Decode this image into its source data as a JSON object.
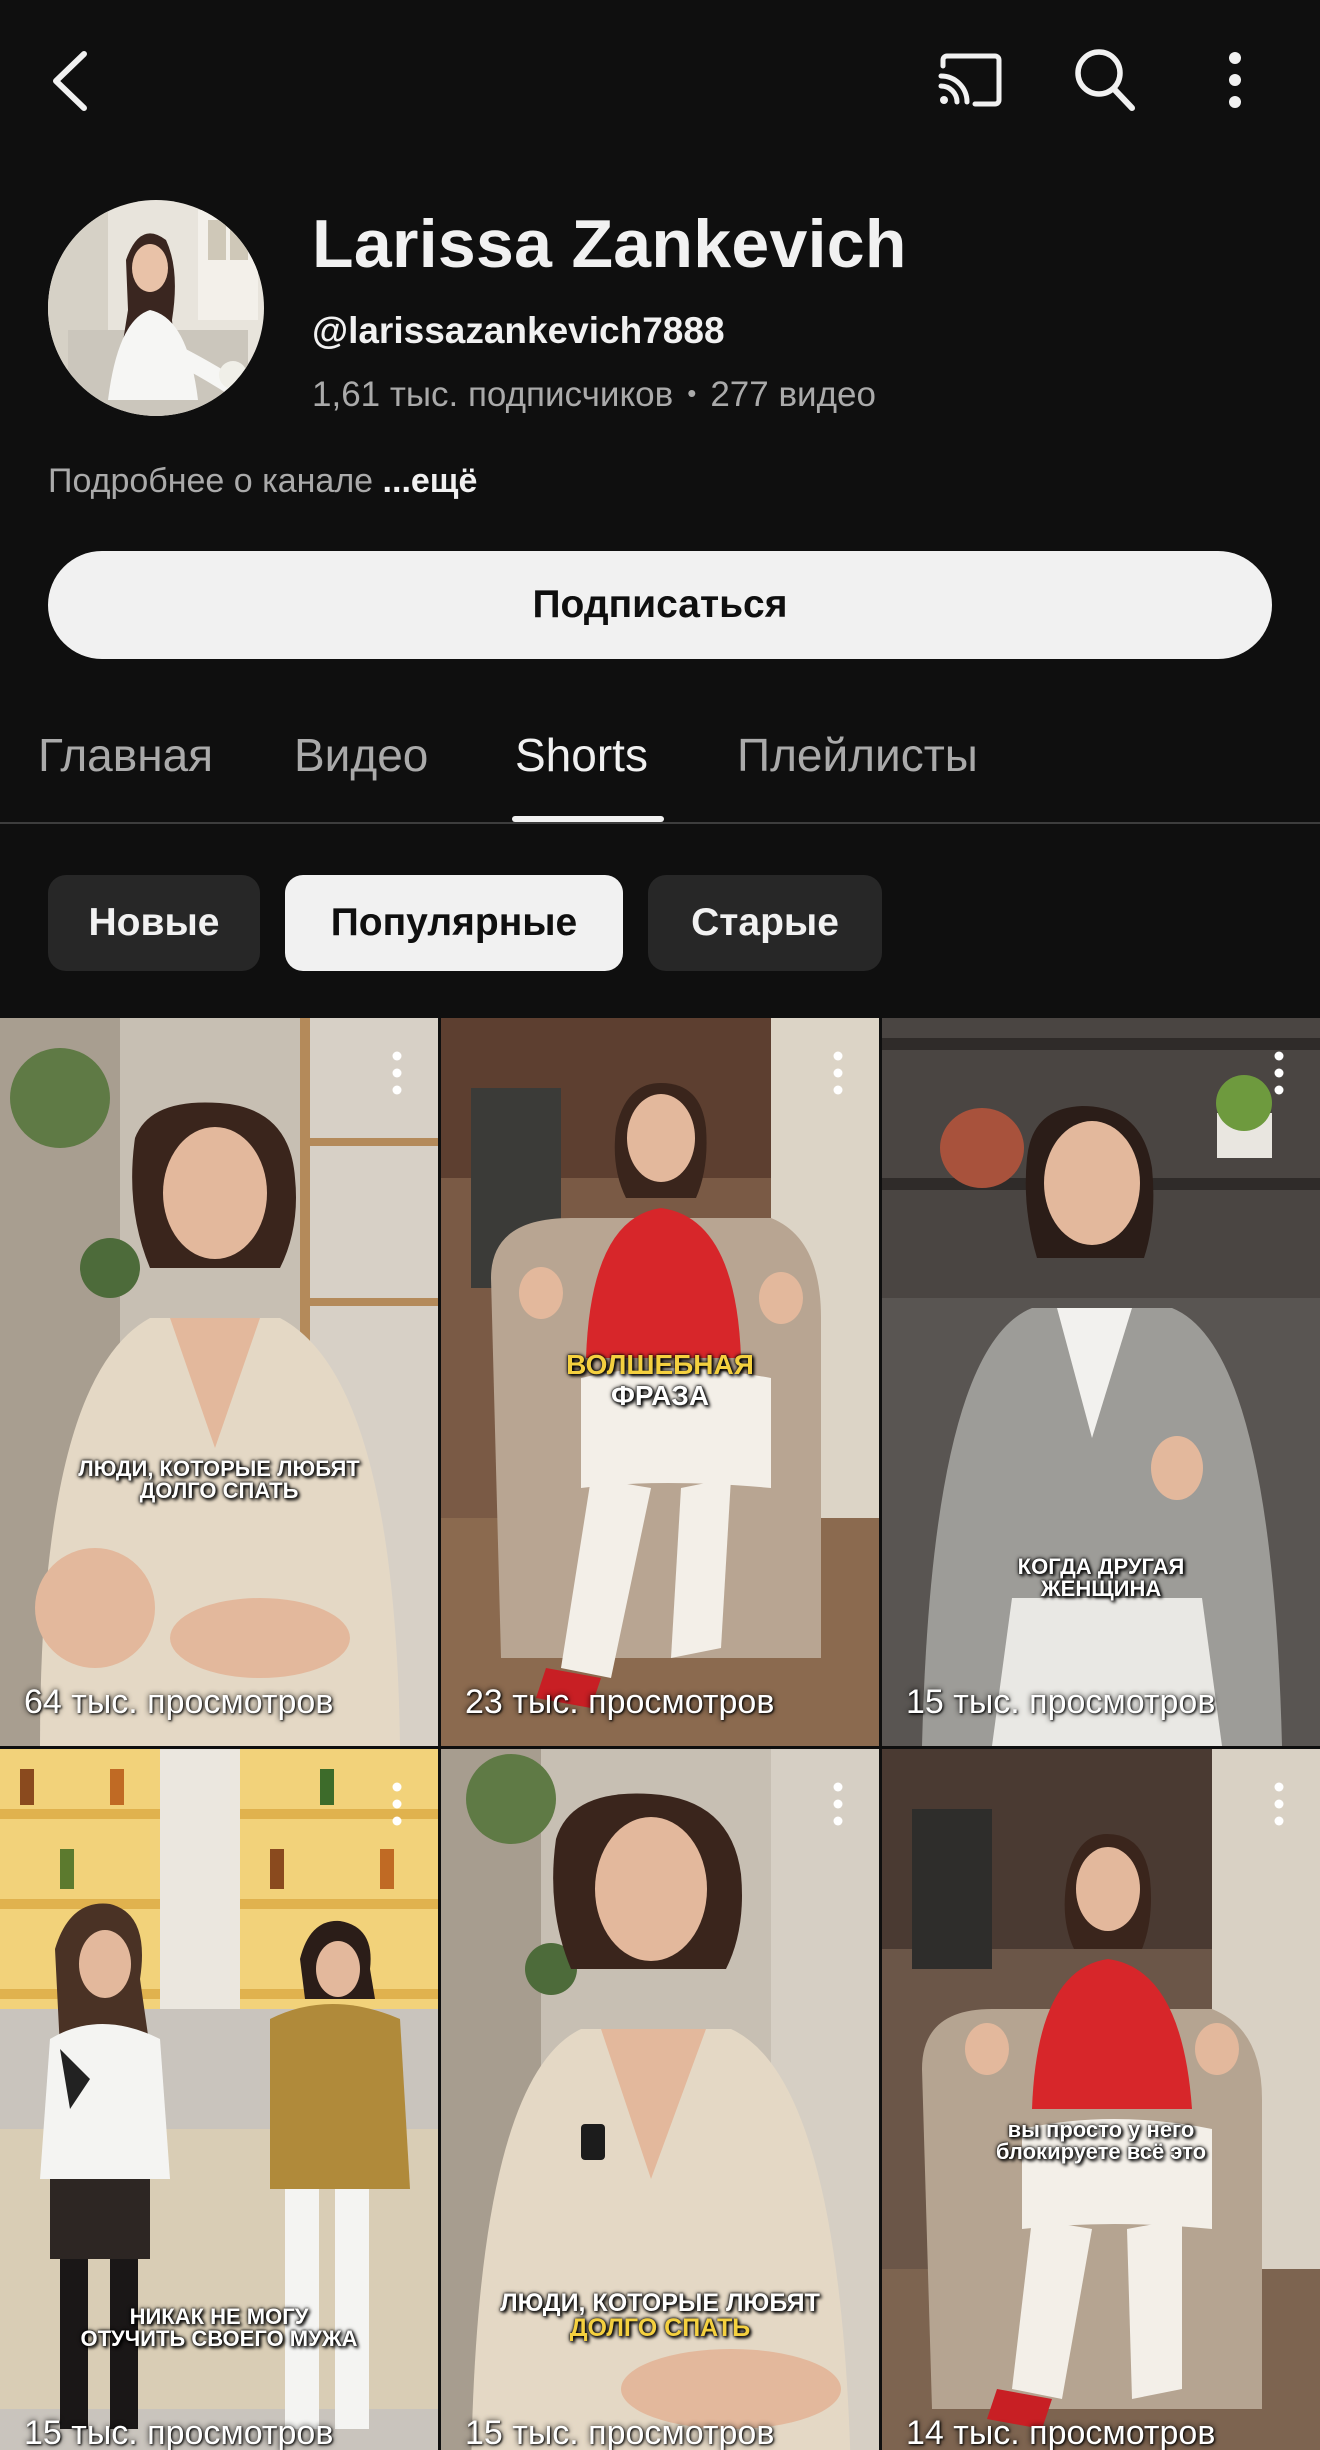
{
  "topbar": {
    "icons": [
      "back-arrow-icon",
      "cast-icon",
      "search-icon",
      "more-vertical-icon"
    ]
  },
  "channel": {
    "name": "Larissa Zankevich",
    "handle": "@larissazankevich7888",
    "subscribers": "1,61 тыс. подписчиков",
    "video_count": "277 видео",
    "about": "Подробнее о канале",
    "about_more": "...ещё",
    "subscribe_label": "Подписаться"
  },
  "tabs": [
    {
      "label": "Главная"
    },
    {
      "label": "Видео"
    },
    {
      "label": "Shorts",
      "active": true
    },
    {
      "label": "Плейлисты"
    }
  ],
  "chips": [
    {
      "label": "Новые"
    },
    {
      "label": "Популярные",
      "selected": true
    },
    {
      "label": "Старые"
    }
  ],
  "shorts": [
    {
      "caption_line1": "Люди, которые любят",
      "caption_line2": "долго спать",
      "views": "64 тыс. просмотров"
    },
    {
      "caption_line1": "Волшебная",
      "caption_line2": "фраза",
      "views": "23 тыс. просмотров"
    },
    {
      "caption_line1": "Когда другая",
      "caption_line2": "женщина",
      "views": "15 тыс. просмотров"
    },
    {
      "caption_line1": "Никак не могу",
      "caption_line2": "отучить своего мужа",
      "views": "15 тыс. просмотров"
    },
    {
      "caption_line1": "Люди, которые любят",
      "caption_line2": "долго спать",
      "views": "15 тыс. просмотров"
    },
    {
      "caption_line1": "вы просто у него",
      "caption_line2": "блокируете всё это",
      "views": "14 тыс. просмотров"
    }
  ],
  "colors": {
    "background": "#0f0f0f",
    "text_primary": "#f1f1f1",
    "text_secondary": "#aaaaaa",
    "chip_bg": "#272727",
    "caption_accent": "#f4d03f"
  }
}
